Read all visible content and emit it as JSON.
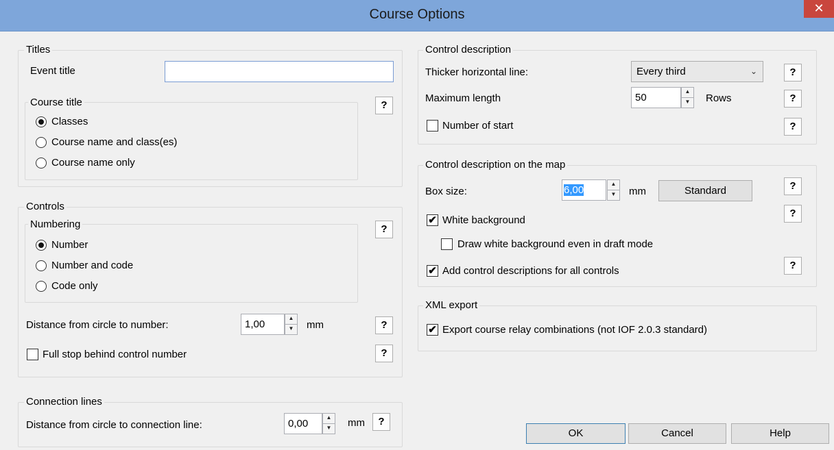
{
  "window": {
    "title": "Course Options",
    "close_glyph": "✕"
  },
  "titles": {
    "legend": "Titles",
    "event_title_label": "Event title",
    "event_title_value": "",
    "course_title": {
      "legend": "Course title",
      "options": [
        "Classes",
        "Course name and class(es)",
        "Course name only"
      ],
      "selected": "Classes"
    }
  },
  "controls": {
    "legend": "Controls",
    "numbering": {
      "legend": "Numbering",
      "options": [
        "Number",
        "Number and code",
        "Code only"
      ],
      "selected": "Number"
    },
    "distance_label": "Distance from circle to number:",
    "distance_value": "1,00",
    "distance_unit": "mm",
    "full_stop_label": "Full stop behind control number",
    "full_stop_checked": false
  },
  "connection_lines": {
    "legend": "Connection lines",
    "distance_label": "Distance from circle to connection line:",
    "distance_value": "0,00",
    "distance_unit": "mm"
  },
  "control_description": {
    "legend": "Control description",
    "thicker_line_label": "Thicker horizontal line:",
    "thicker_line_value": "Every third",
    "max_length_label": "Maximum length",
    "max_length_value": "50",
    "max_length_unit": "Rows",
    "number_of_start_label": "Number of start",
    "number_of_start_checked": false
  },
  "description_on_map": {
    "legend": "Control description on the map",
    "box_size_label": "Box size:",
    "box_size_value": "6,00",
    "box_size_unit": "mm",
    "standard_button": "Standard",
    "white_background_label": "White background",
    "white_background_checked": true,
    "draft_mode_label": "Draw white background even in draft mode",
    "draft_mode_checked": false,
    "all_controls_label": "Add control descriptions for all controls",
    "all_controls_checked": true
  },
  "xml_export": {
    "legend": "XML export",
    "relay_label": "Export course relay combinations (not IOF 2.0.3 standard)",
    "relay_checked": true
  },
  "buttons": {
    "ok": "OK",
    "cancel": "Cancel",
    "help": "Help"
  },
  "help_glyph": "?",
  "icons": {
    "checkmark": "✔",
    "spin_up": "▲",
    "spin_down": "▼",
    "dropdown": "⌄"
  }
}
